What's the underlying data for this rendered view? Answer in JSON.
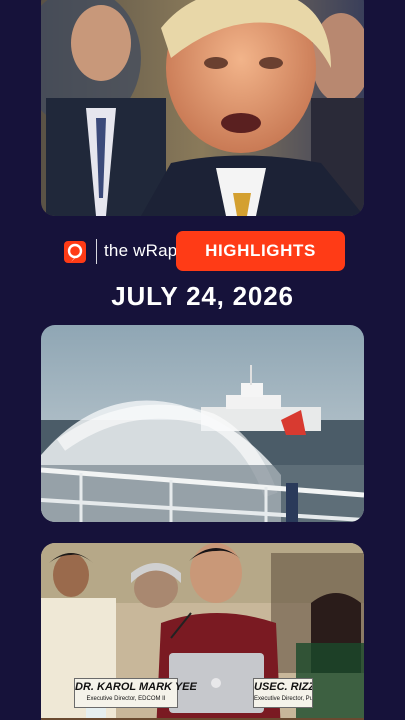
{
  "brand": {
    "show_name": "the wRap",
    "badge": "HIGHLIGHTS",
    "accent_color": "#ff3b16",
    "logo_icon": "rappler-logo-icon"
  },
  "date": "JULY 24, 2026",
  "stories": [
    {
      "image_subject": "man speaking at event"
    },
    {
      "image_subject": "water cannon fired at ship at sea"
    },
    {
      "image_subject": "officials at hearing",
      "nameplates": [
        {
          "name": "DR. KAROL MARK YEE",
          "title": "Executive Director, EDCOM II"
        },
        {
          "name": "USEC. RIZZA",
          "title": "Executive Director, Public Affairs"
        }
      ]
    }
  ]
}
